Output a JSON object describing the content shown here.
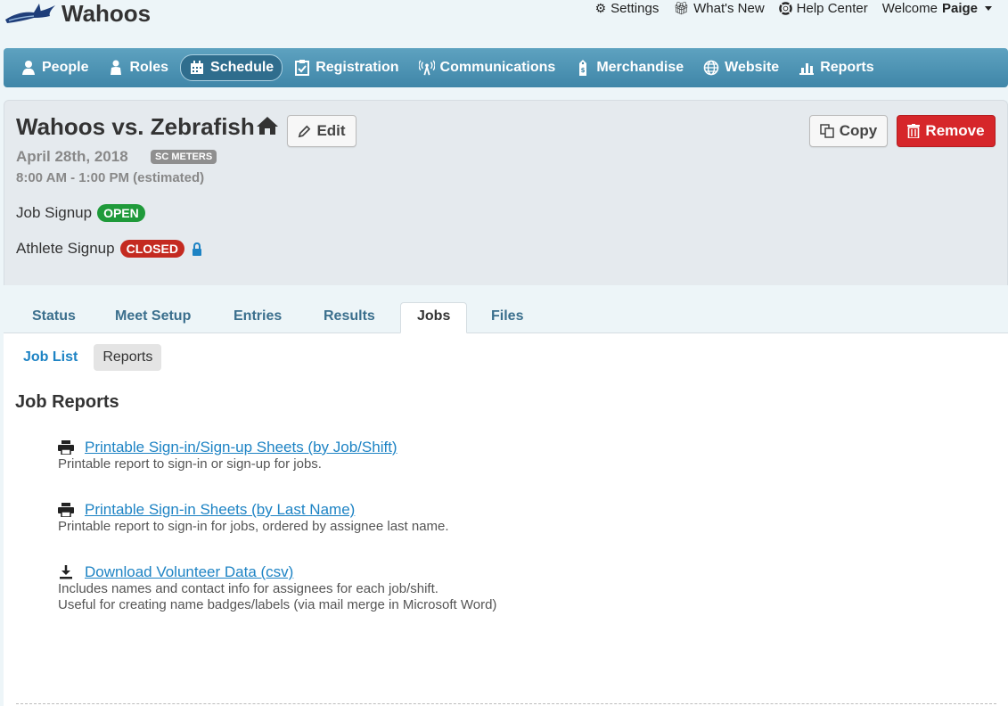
{
  "header": {
    "brand": "Wahoos",
    "links": [
      {
        "icon": "gear-icon",
        "label": "Settings"
      },
      {
        "icon": "gift-icon",
        "label": "What's New"
      },
      {
        "icon": "lifebuoy-icon",
        "label": "Help Center"
      }
    ],
    "welcome_prefix": "Welcome",
    "user": "Paige"
  },
  "nav": {
    "items": [
      {
        "icon": "person-icon",
        "label": "People"
      },
      {
        "icon": "roles-icon",
        "label": "Roles"
      },
      {
        "icon": "calendar-icon",
        "label": "Schedule"
      },
      {
        "icon": "clipboard-check-icon",
        "label": "Registration"
      },
      {
        "icon": "broadcast-icon",
        "label": "Communications"
      },
      {
        "icon": "price-tag-icon",
        "label": "Merchandise"
      },
      {
        "icon": "globe-icon",
        "label": "Website"
      },
      {
        "icon": "bar-chart-icon",
        "label": "Reports"
      }
    ],
    "active": "Schedule"
  },
  "event": {
    "title": "Wahoos vs. Zebrafish",
    "edit_label": "Edit",
    "copy_label": "Copy",
    "remove_label": "Remove",
    "date": "April 28th, 2018",
    "course_badge": "SC METERS",
    "time": "8:00 AM - 1:00 PM (estimated)",
    "job_signup_label": "Job Signup",
    "job_signup_status": "OPEN",
    "athlete_signup_label": "Athlete Signup",
    "athlete_signup_status": "CLOSED"
  },
  "tabs": [
    "Status",
    "Meet Setup",
    "Entries",
    "Results",
    "Jobs",
    "Files"
  ],
  "active_tab": "Jobs",
  "subnav": {
    "job_list": "Job List",
    "reports": "Reports"
  },
  "content": {
    "title": "Job Reports",
    "reports": [
      {
        "icon": "printer-icon",
        "link": "Printable Sign-in/Sign-up Sheets (by Job/Shift)",
        "desc": [
          "Printable report to sign-in or sign-up for jobs."
        ]
      },
      {
        "icon": "printer-icon",
        "link": "Printable Sign-in Sheets (by Last Name)",
        "desc": [
          "Printable report to sign-in for jobs, ordered by assignee last name."
        ]
      },
      {
        "icon": "download-icon",
        "link": "Download Volunteer Data (csv)",
        "desc": [
          "Includes names and contact info for assignees for each job/shift.",
          "Useful for creating name badges/labels (via mail merge in Microsoft Word)"
        ]
      }
    ]
  },
  "colors": {
    "nav_blue": "#4a93b4",
    "link_blue": "#1d83c4",
    "open_green": "#1f9a3a",
    "closed_red": "#c42a20",
    "remove_red": "#d6262a"
  }
}
